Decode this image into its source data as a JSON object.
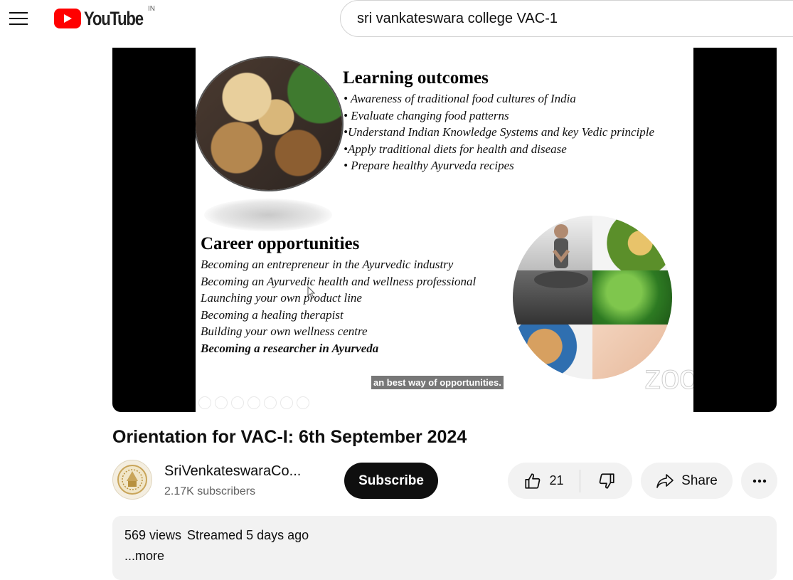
{
  "masthead": {
    "logo_text": "YouTube",
    "country_code": "IN",
    "search_value": "sri vankateswara college VAC-1"
  },
  "slide": {
    "learning_heading": "Learning outcomes",
    "learning_items": [
      "• Awareness of traditional food cultures of India",
      "• Evaluate changing food patterns",
      "•Understand Indian Knowledge Systems and key Vedic principle",
      "•Apply traditional diets for health and disease",
      "• Prepare healthy Ayurveda recipes"
    ],
    "career_heading": "Career opportunities",
    "career_items": [
      "Becoming an entrepreneur in the Ayurvedic industry",
      "Becoming an Ayurvedic health and wellness professional",
      "Launching your own product line",
      "Becoming a healing therapist",
      "Building your own wellness centre",
      "Becoming a researcher in Ayurveda"
    ],
    "caption": "an best way of opportunities.",
    "watermark": "zoom"
  },
  "video": {
    "title": "Orientation for VAC-I: 6th September 2024"
  },
  "channel": {
    "name": "SriVenkateswaraCo...",
    "subscribers": "2.17K subscribers",
    "subscribe_label": "Subscribe"
  },
  "actions": {
    "like_count": "21",
    "share_label": "Share"
  },
  "description": {
    "views": "569 views",
    "streamed": "Streamed 5 days ago",
    "more_label": "...more"
  },
  "colors": {
    "brand_red": "#ff0000",
    "subscribe_bg": "#0f0f0f",
    "chip_bg": "#f2f2f2",
    "secondary_text": "#606060"
  },
  "icons": [
    "menu-icon",
    "youtube-play-icon",
    "like-icon",
    "dislike-icon",
    "share-icon",
    "more-icon"
  ]
}
